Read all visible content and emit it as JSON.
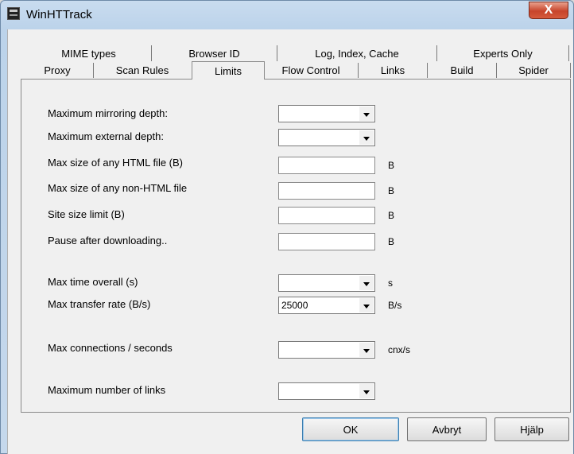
{
  "window": {
    "title": "WinHTTrack",
    "close_glyph": "X"
  },
  "tabs_row1": [
    "MIME types",
    "Browser ID",
    "Log, Index, Cache",
    "Experts Only"
  ],
  "tabs_row2": [
    "Proxy",
    "Scan Rules",
    "Limits",
    "Flow Control",
    "Links",
    "Build",
    "Spider"
  ],
  "active_tab": "Limits",
  "fields": [
    {
      "label": "Maximum mirroring depth:",
      "type": "combo",
      "value": "",
      "unit": ""
    },
    {
      "label": "Maximum external depth:",
      "type": "combo",
      "value": "",
      "unit": ""
    },
    {
      "label": "Max size of any HTML file (B)",
      "type": "text",
      "value": "",
      "unit": "B"
    },
    {
      "label": "Max size of any non-HTML file",
      "type": "text",
      "value": "",
      "unit": "B"
    },
    {
      "label": "Site size limit (B)",
      "type": "text",
      "value": "",
      "unit": "B"
    },
    {
      "label": "Pause after downloading..",
      "type": "text",
      "value": "",
      "unit": "B"
    },
    {
      "label": "Max time overall (s)",
      "type": "combo",
      "value": "",
      "unit": "s"
    },
    {
      "label": "Max transfer rate (B/s)",
      "type": "combo",
      "value": "25000",
      "unit": "B/s"
    },
    {
      "label": "Max connections / seconds",
      "type": "combo",
      "value": "",
      "unit": "cnx/s"
    },
    {
      "label": "Maximum number of links",
      "type": "combo",
      "value": "",
      "unit": ""
    }
  ],
  "buttons": {
    "ok": "OK",
    "cancel": "Avbryt",
    "help": "Hjälp"
  }
}
